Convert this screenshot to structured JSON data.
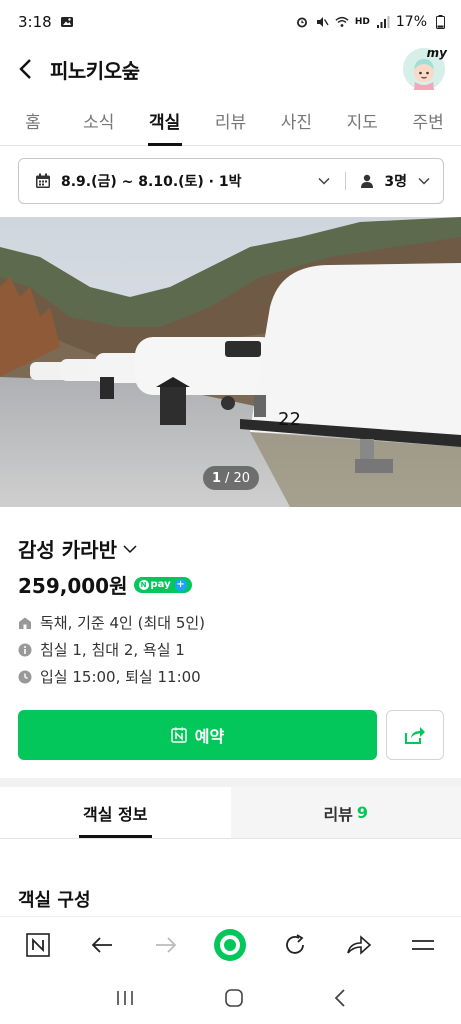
{
  "status_bar": {
    "time": "3:18",
    "battery": "17%"
  },
  "header": {
    "title": "피노키오숲",
    "avatar_label": "my"
  },
  "tabs": [
    {
      "label": "홈",
      "active": false
    },
    {
      "label": "소식",
      "active": false
    },
    {
      "label": "객실",
      "active": true
    },
    {
      "label": "리뷰",
      "active": false
    },
    {
      "label": "사진",
      "active": false
    },
    {
      "label": "지도",
      "active": false
    },
    {
      "label": "주변",
      "active": false
    }
  ],
  "booking": {
    "dates": "8.9.(금) ~ 8.10.(토) · 1박",
    "guests": "3명"
  },
  "photo": {
    "current": "1",
    "total": "/ 20",
    "sign_number": "22"
  },
  "room": {
    "name": "감성 카라반",
    "price": "259,000원",
    "npay_label": "pay",
    "details": [
      {
        "icon": "house-icon",
        "text": "독채, 기준 4인 (최대 5인)"
      },
      {
        "icon": "info-icon",
        "text": "침실 1, 침대 2, 욕실 1"
      },
      {
        "icon": "clock-icon",
        "text": "입실 15:00, 퇴실 11:00"
      }
    ]
  },
  "actions": {
    "reserve_label": "예약"
  },
  "info_tabs": {
    "room_info": "객실 정보",
    "review": "리뷰",
    "review_count": "9"
  },
  "section": {
    "title": "객실 구성"
  },
  "colors": {
    "accent": "#03c75a"
  }
}
